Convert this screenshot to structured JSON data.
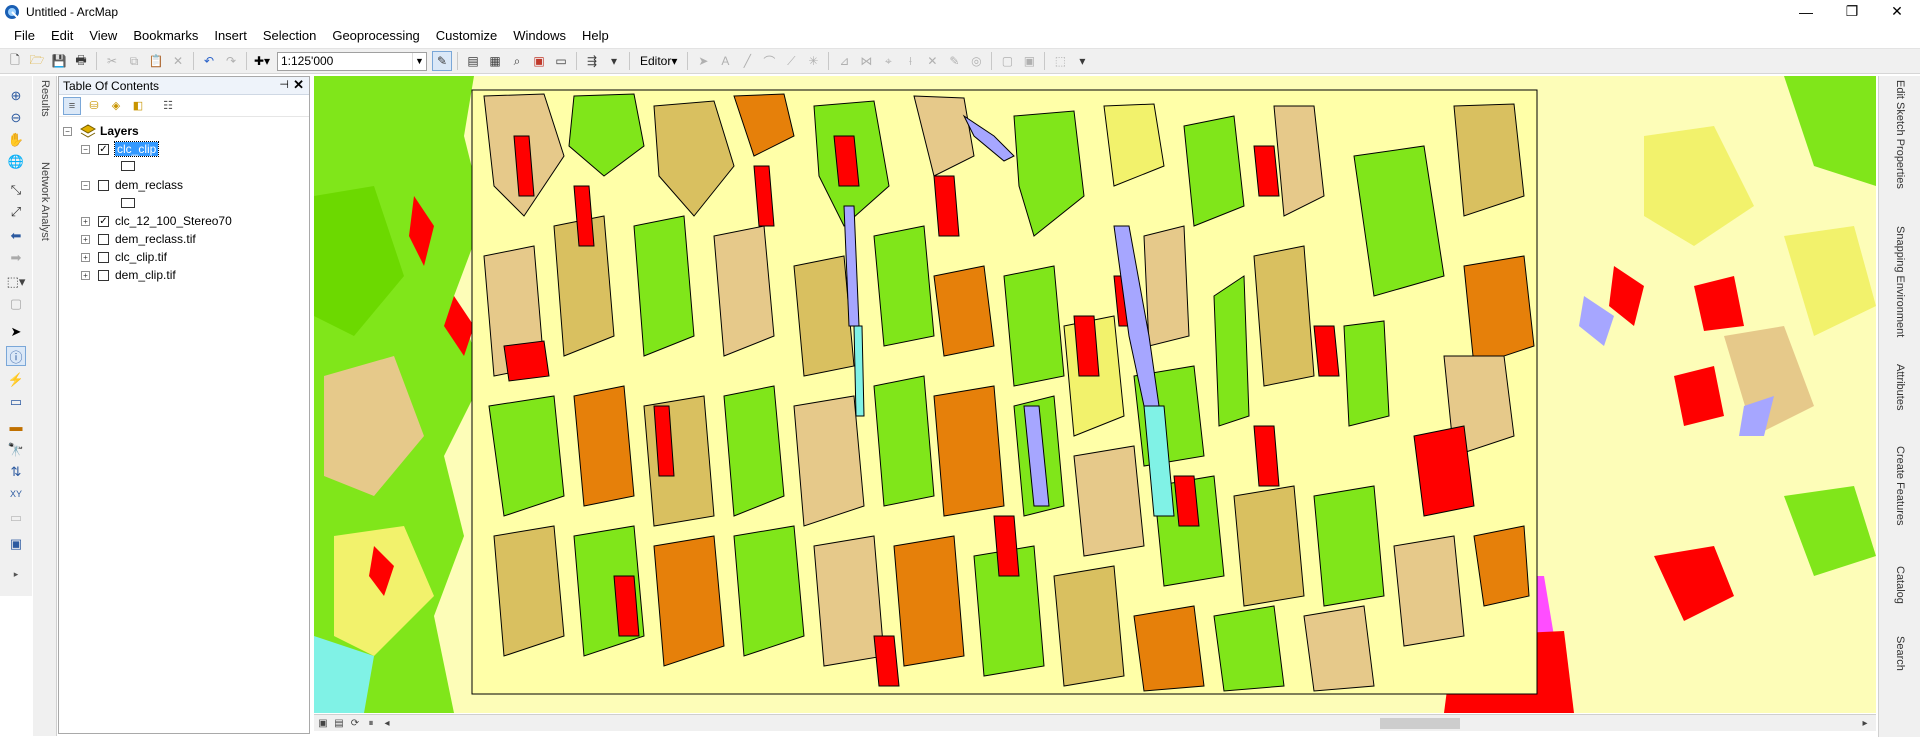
{
  "window": {
    "title": "Untitled - ArcMap",
    "minimize_glyph": "—",
    "restore_glyph": "❐",
    "close_glyph": "✕"
  },
  "menu": {
    "items": [
      "File",
      "Edit",
      "View",
      "Bookmarks",
      "Insert",
      "Selection",
      "Geoprocessing",
      "Customize",
      "Windows",
      "Help"
    ]
  },
  "toolbar": {
    "scale_value": "1:125'000",
    "editor_label": "Editor▾"
  },
  "toc": {
    "title": "Table Of Contents",
    "pin_glyph": "📌",
    "close_glyph": "✕",
    "root_label": "Layers",
    "layers": [
      {
        "name": "clc_clip",
        "checked": true,
        "expanded": true,
        "selected": true
      },
      {
        "name": "dem_reclass",
        "checked": false,
        "expanded": true,
        "selected": false
      },
      {
        "name": "clc_12_100_Stereo70",
        "checked": true,
        "expanded": false,
        "selected": false
      },
      {
        "name": "dem_reclass.tif",
        "checked": false,
        "expanded": false,
        "selected": false
      },
      {
        "name": "clc_clip.tif",
        "checked": false,
        "expanded": false,
        "selected": false
      },
      {
        "name": "dem_clip.tif",
        "checked": false,
        "expanded": false,
        "selected": false
      }
    ]
  },
  "left_vertical_tabs": [
    "Results",
    "Network Analyst"
  ],
  "right_dock_tabs": [
    "Edit Sketch Properties",
    "Snapping Environment",
    "Attributes",
    "Create Features",
    "Catalog",
    "Search"
  ],
  "map": {
    "colors": {
      "background": "#fdfdb8",
      "light_yellow": "#ffffa8",
      "yellow": "#f2f26c",
      "tan": "#e6c98a",
      "olive": "#d9c060",
      "orange": "#e6800a",
      "light_orange": "#f0a860",
      "bright_green": "#80e61a",
      "green": "#6cd900",
      "red": "#ff0000",
      "lavender": "#a6a6ff",
      "cyan": "#80f2e6",
      "magenta": "#ff4dff",
      "outline": "#000000"
    }
  }
}
